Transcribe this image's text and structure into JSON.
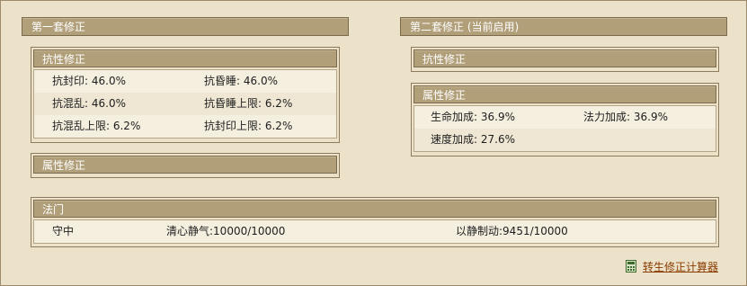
{
  "set1": {
    "header": "第一套修正",
    "resist": {
      "title": "抗性修正",
      "rows": [
        [
          "抗封印: 46.0%",
          "抗昏睡: 46.0%"
        ],
        [
          "抗混乱: 46.0%",
          "抗昏睡上限: 6.2%"
        ],
        [
          "抗混乱上限: 6.2%",
          "抗封印上限: 6.2%"
        ]
      ]
    },
    "attr": {
      "title": "属性修正"
    }
  },
  "set2": {
    "header": "第二套修正 (当前启用)",
    "resist": {
      "title": "抗性修正"
    },
    "attr": {
      "title": "属性修正",
      "rows": [
        [
          "生命加成: 36.9%",
          "法力加成: 36.9%"
        ],
        [
          "速度加成: 27.6%",
          ""
        ]
      ]
    }
  },
  "fameng": {
    "title": "法门",
    "items": [
      "守中",
      "清心静气:10000/10000",
      "以静制动:9451/10000"
    ]
  },
  "footer": {
    "calc_link": "转生修正计算器",
    "calc_icon": "calculator-icon"
  }
}
